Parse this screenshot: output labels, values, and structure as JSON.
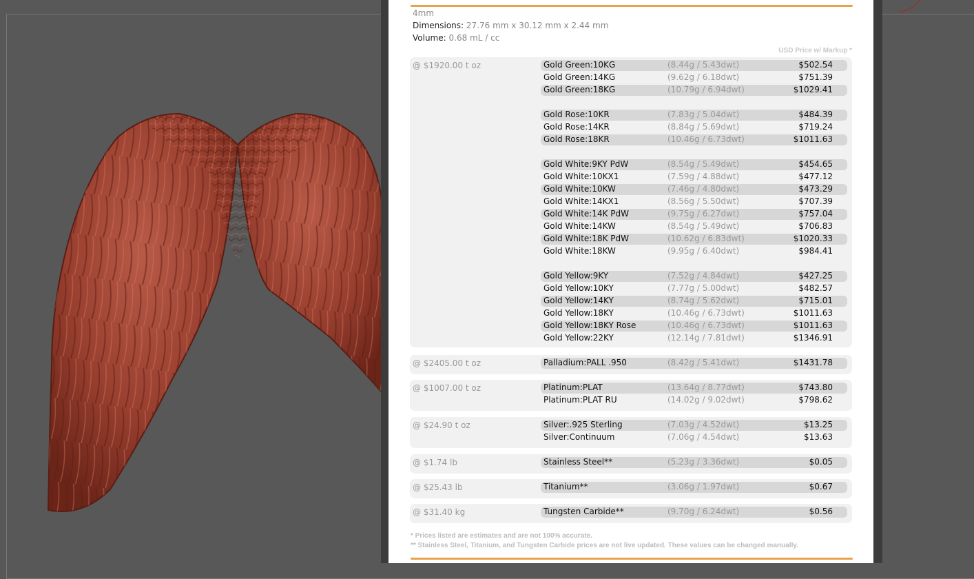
{
  "panel": {
    "size_line": "4mm",
    "dimensions_label": "Dimensions:",
    "dimensions_value": "27.76 mm x 30.12 mm x 2.44 mm",
    "volume_label": "Volume:",
    "volume_value": "0.68 mL / cc",
    "price_header": "USD Price w/ Markup *",
    "accent_color": "#e8a24a"
  },
  "groups": [
    {
      "price": "@ $1920.00 t oz",
      "rows": [
        {
          "name": "Gold Green:10KG",
          "weight": "(8.44g / 5.43dwt)",
          "price": "$502.54"
        },
        {
          "name": "Gold Green:14KG",
          "weight": "(9.62g / 6.18dwt)",
          "price": "$751.39"
        },
        {
          "name": "Gold Green:18KG",
          "weight": "(10.79g / 6.94dwt)",
          "price": "$1029.41"
        },
        {
          "name": "Gold Rose:10KR",
          "weight": "(7.83g / 5.04dwt)",
          "price": "$484.39"
        },
        {
          "name": "Gold Rose:14KR",
          "weight": "(8.84g / 5.69dwt)",
          "price": "$719.24"
        },
        {
          "name": "Gold Rose:18KR",
          "weight": "(10.46g / 6.73dwt)",
          "price": "$1011.63"
        },
        {
          "name": "Gold White:9KY PdW",
          "weight": "(8.54g / 5.49dwt)",
          "price": "$454.65"
        },
        {
          "name": "Gold White:10KX1",
          "weight": "(7.59g / 4.88dwt)",
          "price": "$477.12"
        },
        {
          "name": "Gold White:10KW",
          "weight": "(7.46g / 4.80dwt)",
          "price": "$473.29"
        },
        {
          "name": "Gold White:14KX1",
          "weight": "(8.56g / 5.50dwt)",
          "price": "$707.39"
        },
        {
          "name": "Gold White:14K PdW",
          "weight": "(9.75g / 6.27dwt)",
          "price": "$757.04"
        },
        {
          "name": "Gold White:14KW",
          "weight": "(8.54g / 5.49dwt)",
          "price": "$706.83"
        },
        {
          "name": "Gold White:18K PdW",
          "weight": "(10.62g / 6.83dwt)",
          "price": "$1020.33"
        },
        {
          "name": "Gold White:18KW",
          "weight": "(9.95g / 6.40dwt)",
          "price": "$984.41"
        },
        {
          "name": "Gold Yellow:9KY",
          "weight": "(7.52g / 4.84dwt)",
          "price": "$427.25"
        },
        {
          "name": "Gold Yellow:10KY",
          "weight": "(7.77g / 5.00dwt)",
          "price": "$482.57"
        },
        {
          "name": "Gold Yellow:14KY",
          "weight": "(8.74g / 5.62dwt)",
          "price": "$715.01"
        },
        {
          "name": "Gold Yellow:18KY",
          "weight": "(10.46g / 6.73dwt)",
          "price": "$1011.63"
        },
        {
          "name": "Gold Yellow:18KY Rose",
          "weight": "(10.46g / 6.73dwt)",
          "price": "$1011.63"
        },
        {
          "name": "Gold Yellow:22KY",
          "weight": "(12.14g / 7.81dwt)",
          "price": "$1346.91"
        }
      ]
    },
    {
      "price": "@ $2405.00 t oz",
      "rows": [
        {
          "name": "Palladium:PALL .950",
          "weight": "(8.42g / 5.41dwt)",
          "price": "$1431.78"
        }
      ]
    },
    {
      "price": "@ $1007.00 t oz",
      "rows": [
        {
          "name": "Platinum:PLAT",
          "weight": "(13.64g / 8.77dwt)",
          "price": "$743.80"
        },
        {
          "name": "Platinum:PLAT RU",
          "weight": "(14.02g / 9.02dwt)",
          "price": "$798.62"
        }
      ]
    },
    {
      "price": "@ $24.90 t oz",
      "rows": [
        {
          "name": "Silver:.925 Sterling",
          "weight": "(7.03g / 4.52dwt)",
          "price": "$13.25"
        },
        {
          "name": "Silver:Continuum",
          "weight": "(7.06g / 4.54dwt)",
          "price": "$13.63"
        }
      ]
    },
    {
      "price": "@ $1.74 lb",
      "rows": [
        {
          "name": "Stainless Steel**",
          "weight": "(5.23g / 3.36dwt)",
          "price": "$0.05"
        }
      ]
    },
    {
      "price": "@ $25.43 lb",
      "rows": [
        {
          "name": "Titanium**",
          "weight": "(3.06g / 1.97dwt)",
          "price": "$0.67"
        }
      ]
    },
    {
      "price": "@ $31.40 kg",
      "rows": [
        {
          "name": "Tungsten Carbide**",
          "weight": "(9.70g / 6.24dwt)",
          "price": "$0.56"
        }
      ]
    }
  ],
  "footnotes": {
    "note1": "* Prices listed are estimates and are not 100% accurate.",
    "note2": "** Stainless Steel, Titanium, and Tungsten Carbide prices are not live updated. These values can be changed manually."
  }
}
